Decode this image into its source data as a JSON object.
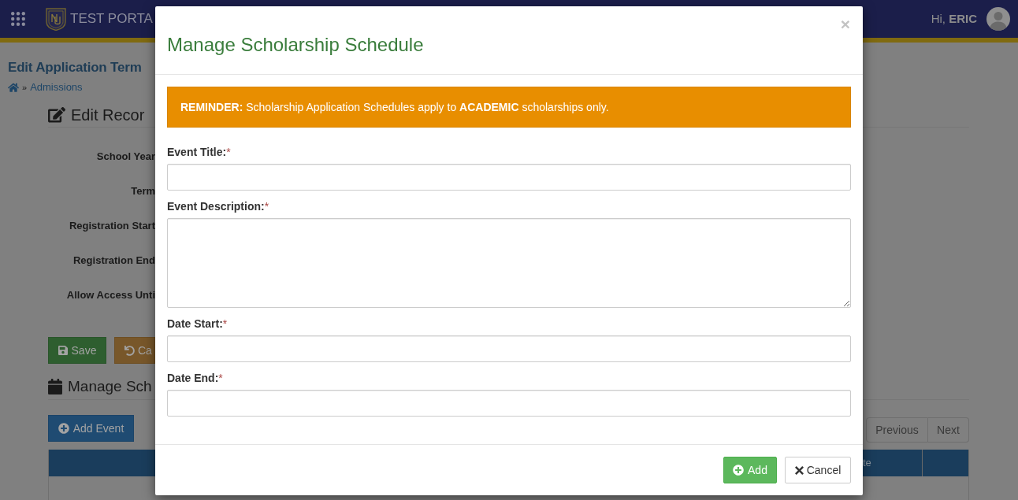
{
  "header": {
    "brand": "TEST PORTA",
    "greeting": "Hi, **ERIC**"
  },
  "page": {
    "title": "Edit Application Term",
    "breadcrumb": {
      "separator": "»",
      "link": "Admissions"
    }
  },
  "edit_record": {
    "heading": "Edit Recor",
    "fields": [
      "School Year",
      "Term",
      "Registration Start",
      "Registration End",
      "Allow Access Unti"
    ],
    "buttons": [
      {
        "label": "Save",
        "kind": "save"
      },
      {
        "label": "Ca",
        "kind": "cancel"
      }
    ]
  },
  "schedule": {
    "heading": "Manage Sch",
    "add_button": "Add Event",
    "pagination": [
      "Previous",
      "Next"
    ],
    "table": {
      "column_header": "te"
    }
  },
  "modal": {
    "title": "Manage Scholarship Schedule",
    "close": "×",
    "alert": "**REMINDER:** Scholarship Application Schedules apply to **ACADEMIC** scholarships only.",
    "fields": [
      {
        "label": "Event Title:",
        "required_mark": "*",
        "kind": "input"
      },
      {
        "label": "Event Description:",
        "required_mark": "*",
        "kind": "textarea"
      },
      {
        "label": "Date Start:",
        "required_mark": "*",
        "kind": "input"
      },
      {
        "label": "Date End:",
        "required_mark": "*",
        "kind": "input"
      }
    ],
    "buttons": [
      {
        "label": "Add",
        "kind": "primary"
      },
      {
        "label": "Cancel",
        "kind": "default"
      }
    ]
  }
}
